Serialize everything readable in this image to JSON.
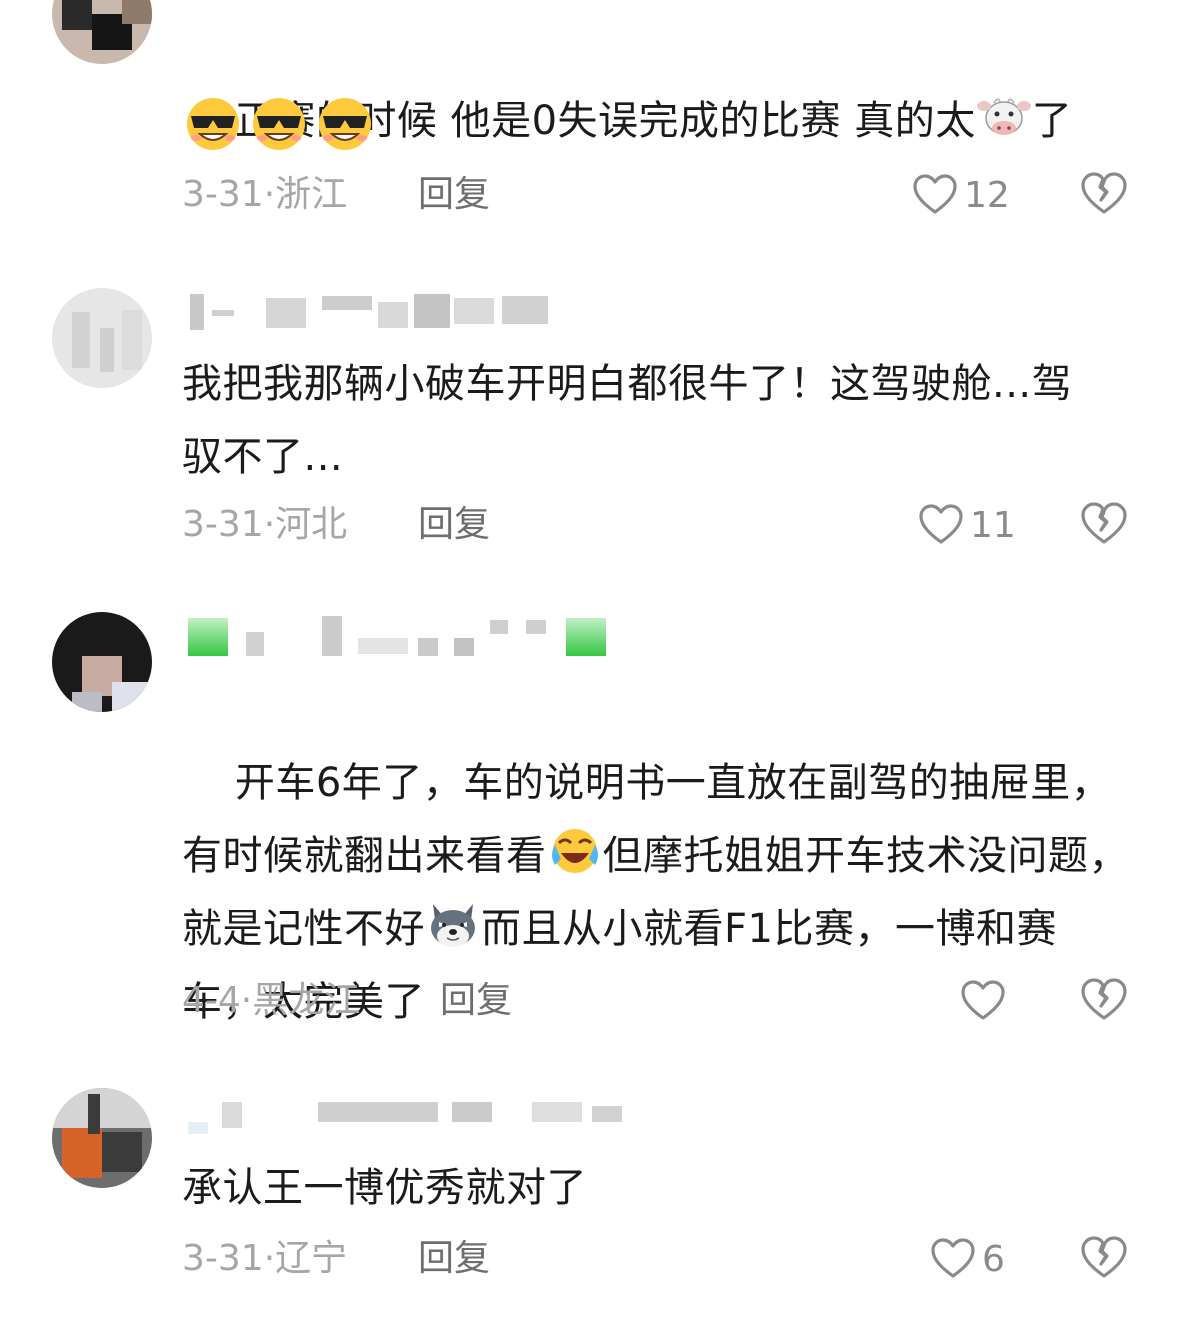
{
  "comments": [
    {
      "text": "正赛的时候 他是0失误完成的比赛 真的太",
      "text_suffix": "了",
      "inline_emoji": "cow-face",
      "emoji_row": [
        "sunglasses-grin",
        "sunglasses-grin",
        "sunglasses-grin"
      ],
      "date": "3-31·",
      "region": "浙江",
      "reply_label": "回复",
      "likes": "12"
    },
    {
      "text": "我把我那辆小破车开明白都很牛了！这驾驶舱...驾驭不了...",
      "date": "3-31·",
      "region": "河北",
      "reply_label": "回复",
      "likes": "11"
    },
    {
      "text_part1": "开车6年了，车的说明书一直放在副驾的抽屉里，有时候就翻出来看看",
      "emoji1": "crying-laughing",
      "text_part2": "但摩托姐姐开车技术没问题，就是记性不好",
      "emoji2": "husky-dog",
      "text_part3": "而且从小就看F1比赛，一博和赛车，太完美了",
      "date": "4-4·",
      "region": "黑龙江",
      "reply_label": "回复",
      "likes": ""
    },
    {
      "text": "承认王一博优秀就对了",
      "date": "3-31·",
      "region": "辽宁",
      "reply_label": "回复",
      "likes": "6"
    }
  ],
  "colors": {
    "text": "#1b1b1b",
    "meta": "#a6a6a6",
    "reply": "#6e6e6e",
    "icon": "#8a8a8a",
    "green_badge": "#3dcc4a"
  }
}
